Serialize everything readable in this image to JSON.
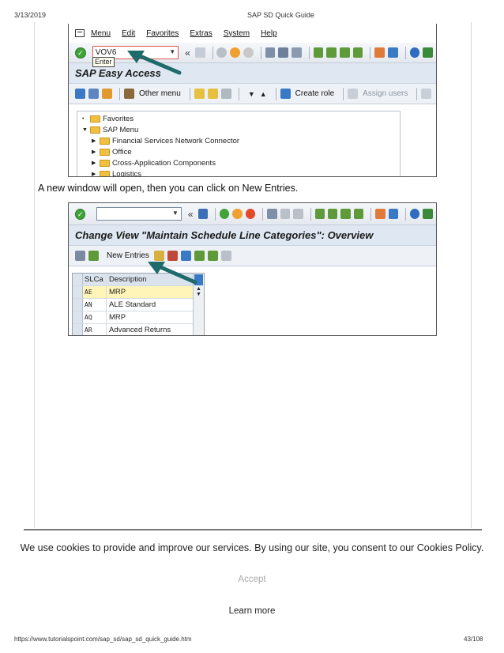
{
  "page_header": {
    "date": "3/13/2019",
    "title": "SAP SD Quick Guide"
  },
  "page_footer": {
    "url": "https://www.tutorialspoint.com/sap_sd/sap_sd_quick_guide.htm",
    "page": "43/108"
  },
  "window1": {
    "menu": [
      "Menu",
      "Edit",
      "Favorites",
      "Extras",
      "System",
      "Help"
    ],
    "command_value": "VOV6",
    "tooltip": "Enter",
    "title": "SAP Easy Access",
    "app_toolbar": {
      "other_menu": "Other menu",
      "create_role": "Create role",
      "assign_users": "Assign users"
    },
    "tree": {
      "favorites": "Favorites",
      "sap_menu": "SAP Menu",
      "children": [
        "Financial Services Network Connector",
        "Office",
        "Cross-Application Components",
        "Logistics"
      ]
    }
  },
  "instruction": "A new window will open, then you can click on New Entries.",
  "window2": {
    "command_value": "",
    "title": "Change View \"Maintain Schedule Line Categories\": Overview",
    "new_entries": "New Entries",
    "table": {
      "headers": [
        "SLCa",
        "Description"
      ],
      "rows": [
        {
          "code": "AE",
          "desc": "MRP"
        },
        {
          "code": "AN",
          "desc": "ALE Standard"
        },
        {
          "code": "AQ",
          "desc": "MRP"
        },
        {
          "code": "AR",
          "desc": "Advanced Returns"
        }
      ]
    }
  },
  "cookie_banner": {
    "text": "We use cookies to provide and improve our services. By using our site, you consent to our Cookies Policy.",
    "accept": "Accept",
    "learn_more": "Learn more"
  },
  "colors": {
    "ok_green": "#3fa33a",
    "title_bg": "#dfe8f2",
    "arrow": "#1f6b6b",
    "highlight": "#fff5b8"
  }
}
